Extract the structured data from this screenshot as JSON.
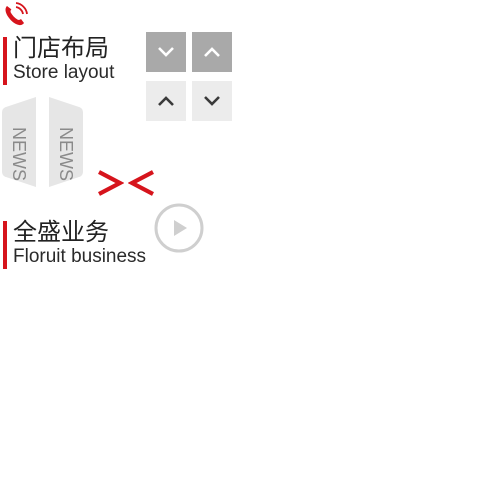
{
  "store_section": {
    "title_cn": "门店布局",
    "title_en": "Store layout"
  },
  "business_section": {
    "title_cn": "全盛业务",
    "title_en": "Floruit business"
  },
  "news_tabs": {
    "left_label": "NEWS",
    "right_label": "NEWS"
  },
  "colors": {
    "accent_red": "#d6141c",
    "button_dark": "#a9a9a9",
    "button_light": "#ececec",
    "tab_gray": "#e6e6e6",
    "text_gray": "#8a8a8a"
  },
  "icons": {
    "phone": "phone-icon",
    "arrow_down": "chevron-down-icon",
    "arrow_up": "chevron-up-icon",
    "chevron_right": "chevron-right-icon",
    "chevron_left": "chevron-left-icon",
    "play": "play-icon"
  }
}
